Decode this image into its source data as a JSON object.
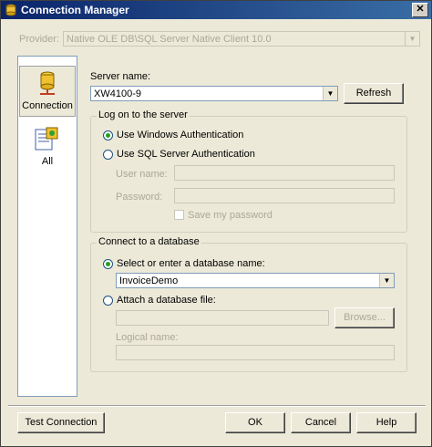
{
  "window": {
    "title": "Connection Manager",
    "close_glyph": "✕"
  },
  "provider": {
    "label": "Provider:",
    "value": "Native OLE DB\\SQL Server Native Client 10.0"
  },
  "sidebar": {
    "items": [
      {
        "label": "Connection",
        "icon": "database-icon"
      },
      {
        "label": "All",
        "icon": "properties-icon"
      }
    ]
  },
  "server": {
    "label": "Server name:",
    "value": "XW4100-9",
    "refresh_label": "Refresh"
  },
  "logon": {
    "title": "Log on to the server",
    "windows_auth": "Use Windows Authentication",
    "sql_auth": "Use SQL Server Authentication",
    "user_label": "User name:",
    "password_label": "Password:",
    "save_password": "Save my password"
  },
  "database": {
    "title": "Connect to a database",
    "select_label": "Select or enter a database name:",
    "db_value": "InvoiceDemo",
    "attach_label": "Attach a database file:",
    "browse_label": "Browse...",
    "logical_label": "Logical name:"
  },
  "buttons": {
    "test": "Test Connection",
    "ok": "OK",
    "cancel": "Cancel",
    "help": "Help"
  }
}
